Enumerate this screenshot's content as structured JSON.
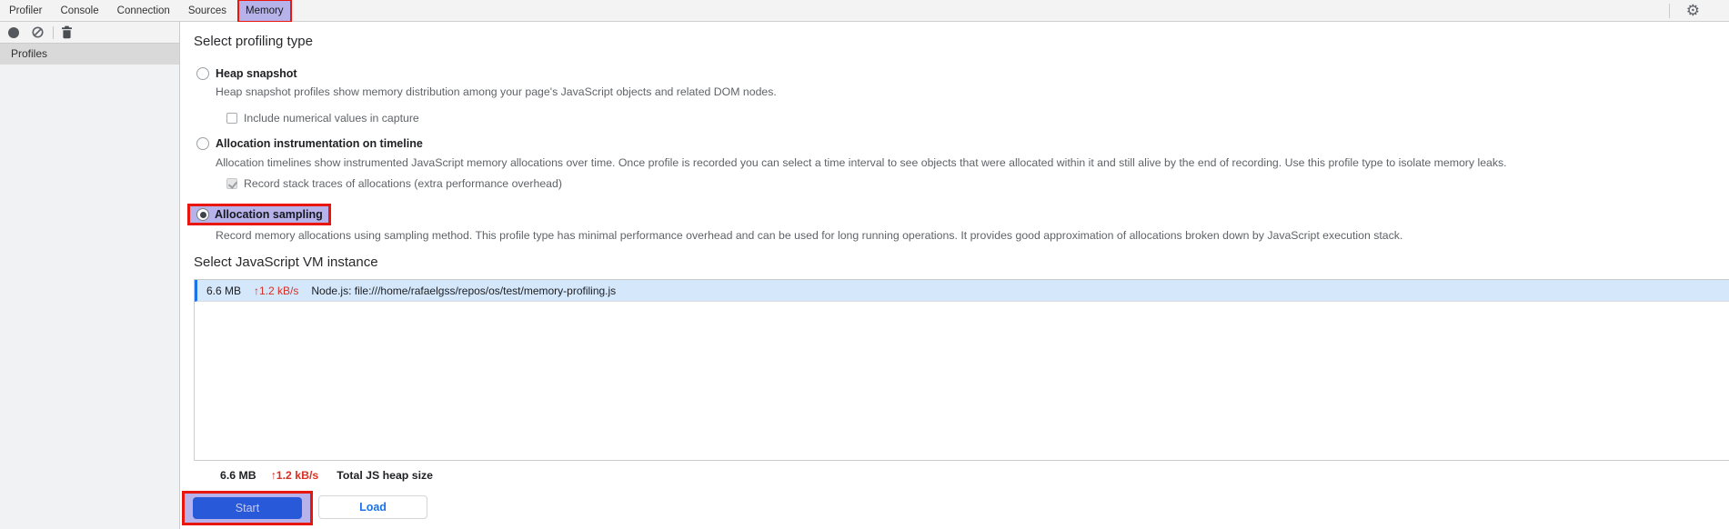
{
  "tabbar": {
    "tabs": [
      {
        "label": "Profiler"
      },
      {
        "label": "Console"
      },
      {
        "label": "Connection"
      },
      {
        "label": "Sources"
      },
      {
        "label": "Memory"
      }
    ],
    "active_tab": "Memory",
    "settings_icon": "gear"
  },
  "toolbar": {
    "record_icon": "record-circle",
    "clear_icon": "block-circle",
    "delete_icon": "trash"
  },
  "sidebar": {
    "profiles_label": "Profiles"
  },
  "profiling": {
    "heading": "Select profiling type",
    "options": [
      {
        "label": "Heap snapshot",
        "selected": false,
        "description": "Heap snapshot profiles show memory distribution among your page's JavaScript objects and related DOM nodes.",
        "checkbox": {
          "label": "Include numerical values in capture",
          "checked": false
        }
      },
      {
        "label": "Allocation instrumentation on timeline",
        "selected": false,
        "description": "Allocation timelines show instrumented JavaScript memory allocations over time. Once profile is recorded you can select a time interval to see objects that were allocated within it and still alive by the end of recording. Use this profile type to isolate memory leaks.",
        "checkbox": {
          "label": "Record stack traces of allocations (extra performance overhead)",
          "checked": true
        }
      },
      {
        "label": "Allocation sampling",
        "selected": true,
        "highlighted": true,
        "description": "Record memory allocations using sampling method. This profile type has minimal performance overhead and can be used for long running operations. It provides good approximation of allocations broken down by JavaScript execution stack."
      }
    ]
  },
  "vm": {
    "heading": "Select JavaScript VM instance",
    "rows": [
      {
        "size": "6.6 MB",
        "rate": "↑1.2 kB/s",
        "name": "Node.js: file:///home/rafaelgss/repos/os/test/memory-profiling.js",
        "selected": true
      }
    ],
    "total": {
      "size": "6.6 MB",
      "rate": "↑1.2 kB/s",
      "label": "Total JS heap size"
    }
  },
  "actions": {
    "start_label": "Start",
    "load_label": "Load"
  },
  "colors": {
    "annotation_red": "#e8160c",
    "annotation_lavender": "#b7b3ea",
    "accent_blue": "#1a73e8",
    "selected_row_bg": "#d4e7fb",
    "start_button_bg": "#2859d8",
    "rate_red": "#d93025",
    "panel_gray": "#f3f3f3"
  }
}
